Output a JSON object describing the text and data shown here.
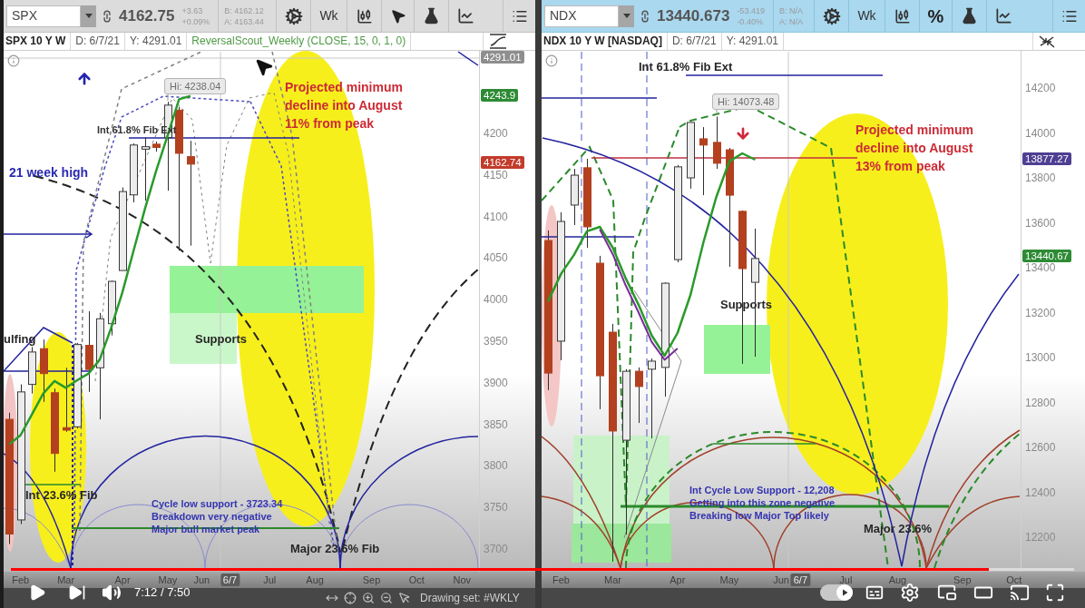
{
  "panels": [
    {
      "selected": false,
      "toolbar": {
        "symbol": "SPX",
        "price": "4162.75",
        "change": "+3.63",
        "change_percent": "+0.09%",
        "bid": "B: 4162.12",
        "ask": "A: 4163.44",
        "interval": "Wk"
      },
      "header": {
        "title": "SPX 10 Y W",
        "date": "D: 6/7/21",
        "y_value": "Y: 4291.01",
        "study": "ReversalScout_Weekly (CLOSE, 15, 0, 1, 0)"
      },
      "annotations": [
        {
          "kind": "price_label",
          "text": "Hi: 4238.04"
        },
        {
          "kind": "small_label",
          "text": "Int 61.8% Fib Ext"
        },
        {
          "kind": "callout",
          "lines": [
            "Projected minimum",
            "decline into August",
            "11% from peak"
          ]
        },
        {
          "kind": "heading",
          "text": "21 week high"
        },
        {
          "kind": "label",
          "text": "ulfing"
        },
        {
          "kind": "label",
          "text": "Supports"
        },
        {
          "kind": "label",
          "text": "Int 23.6% Fib"
        },
        {
          "kind": "note",
          "lines": [
            "Cycle low support - 3723.34",
            "Breakdown very negative",
            "Major bull market peak"
          ]
        },
        {
          "kind": "label",
          "text": "Major 23.6% Fib"
        }
      ],
      "price_tags": [
        {
          "text": "4291.01",
          "color": "#8e8e8e"
        },
        {
          "text": "4243.9",
          "color": "#2e8b35"
        },
        {
          "text": "4162.74",
          "color": "#c23b2b"
        }
      ],
      "chart_data": {
        "type": "candlestick",
        "categories": [
          null,
          "Feb",
          null,
          null,
          null,
          "Mar",
          null,
          null,
          null,
          null,
          "Apr",
          null,
          null,
          null,
          "May",
          null,
          null,
          "Jun",
          null,
          null,
          null,
          null,
          null,
          "Jul",
          null,
          null,
          null,
          "Aug",
          null,
          null,
          null,
          null,
          "Sep",
          null,
          null,
          null,
          "Oct",
          null,
          null,
          null,
          "Nov",
          null
        ],
        "ylim": [
          3672.7,
          4299.3
        ],
        "yticks": [
          4200,
          4150,
          4100,
          4050,
          4000,
          3950,
          3900,
          3850,
          3800,
          3750,
          3700
        ],
        "ohlc": [
          [
            3856,
            3864,
            3706,
            3718
          ],
          [
            3735,
            3898,
            3730,
            3889
          ],
          [
            3898,
            3943,
            3887,
            3937
          ],
          [
            3941,
            3952,
            3877,
            3911
          ],
          [
            3888,
            3893,
            3793,
            3815
          ],
          [
            3846,
            3918,
            3841,
            3843
          ],
          [
            3847,
            3948,
            3845,
            3946
          ],
          [
            3945,
            3986,
            3889,
            3916
          ],
          [
            3918,
            3984,
            3856,
            3977
          ],
          [
            3971,
            4023,
            3957,
            4022
          ],
          [
            4035,
            4135,
            4035,
            4130
          ],
          [
            4126,
            4188,
            4117,
            4186
          ],
          [
            4181,
            4195,
            4119,
            4184
          ],
          [
            4187,
            4190,
            4178,
            4183
          ],
          [
            4195,
            4238,
            4131,
            4234
          ],
          [
            4228,
            4232,
            4059,
            4176
          ],
          [
            4172,
            4191,
            4065,
            4163
          ],
          null,
          null,
          null,
          null,
          null,
          null,
          null,
          null,
          null,
          null,
          null,
          null,
          null,
          null,
          null,
          null,
          null,
          null,
          null,
          null,
          null,
          null,
          null,
          null,
          null
        ],
        "series": [
          {
            "type": "line",
            "color": "#2a9a2a",
            "values": [
              3826,
              3837,
              3862,
              3887,
              3902,
              3894,
              3903,
              3911,
              3928,
              3966,
              4009,
              4060,
              4110,
              4156,
              4198,
              4241,
              4245,
              null,
              null,
              null,
              null,
              null,
              null,
              null,
              null,
              null,
              null,
              null,
              null,
              null,
              null,
              null,
              null,
              null,
              null,
              null,
              null,
              null,
              null,
              null,
              null,
              null
            ]
          }
        ]
      },
      "date_tag": "6/7",
      "bottom_bar": {
        "drawing_set": "Drawing set: #WKLY"
      }
    },
    {
      "selected": true,
      "toolbar": {
        "symbol": "NDX",
        "price": "13440.673",
        "change": "-53.419",
        "change_percent": "-0.40%",
        "bid": "B: N/A",
        "ask": "A: N/A",
        "interval": "Wk",
        "percent": "%"
      },
      "header": {
        "title": "NDX 10 Y W [NASDAQ]",
        "date": "D: 6/7/21",
        "y_value": "Y: 4291.01"
      },
      "annotations": [
        {
          "kind": "label",
          "text": "Int 61.8% Fib Ext"
        },
        {
          "kind": "price_label",
          "text": "Hi: 14073.48"
        },
        {
          "kind": "callout",
          "lines": [
            "Projected minimum",
            "decline into August",
            "13% from peak"
          ]
        },
        {
          "kind": "label",
          "text": "Supports"
        },
        {
          "kind": "note",
          "lines": [
            "Int Cycle Low Support - 12,208",
            "Getting into this zone negative",
            "Breaking low Major Top likely"
          ]
        },
        {
          "kind": "label",
          "text": "Major 23.6%"
        }
      ],
      "price_tags": [
        {
          "text": "13877.27",
          "color": "#4f3f92"
        },
        {
          "text": "13440.67",
          "color": "#2e8b35"
        }
      ],
      "chart_data": {
        "type": "candlestick",
        "categories": [
          null,
          "Feb",
          null,
          null,
          null,
          "Mar",
          null,
          null,
          null,
          null,
          "Apr",
          null,
          null,
          null,
          "May",
          null,
          null,
          null,
          "Jun",
          null,
          null,
          null,
          null,
          "Jul",
          null,
          null,
          null,
          "Aug",
          null,
          null,
          null,
          null,
          "Sep",
          null,
          null,
          null,
          "Oct"
        ],
        "ylim": [
          12046.5,
          14365.7
        ],
        "yticks": [
          14200,
          14000,
          13800,
          13600,
          13400,
          13200,
          13000,
          12800,
          12600,
          12400,
          12200
        ],
        "ohlc": [
          [
            13521,
            13566,
            12855,
            12931
          ],
          [
            13073,
            13647,
            12988,
            13606
          ],
          [
            13679,
            13840,
            13590,
            13812
          ],
          [
            13845,
            13885,
            13489,
            13582
          ],
          [
            13420,
            13453,
            12770,
            12919
          ],
          [
            13113,
            13150,
            12091,
            12673
          ],
          [
            12632,
            12948,
            12212,
            12939
          ],
          [
            12939,
            12956,
            12709,
            12871
          ],
          [
            12948,
            12996,
            12640,
            12984
          ],
          [
            12956,
            13335,
            12826,
            13331
          ],
          [
            13436,
            13857,
            13424,
            13849
          ],
          [
            13800,
            14047,
            13752,
            14047
          ],
          [
            13974,
            14026,
            13723,
            13946
          ],
          [
            13958,
            14073,
            13840,
            13865
          ],
          [
            13925,
            13933,
            13404,
            13723
          ],
          [
            13651,
            13655,
            12972,
            13396
          ],
          [
            13335,
            13574,
            13004,
            13441
          ],
          null,
          null,
          null,
          null,
          null,
          null,
          null,
          null,
          null,
          null,
          null,
          null,
          null,
          null,
          null,
          null,
          null,
          null,
          null,
          null
        ],
        "series": [
          {
            "type": "line",
            "color": "#2a9a2a",
            "values": [
              13250,
              13372,
              13457,
              13562,
              13582,
              13489,
              13352,
              13234,
              13099,
              13008,
              13109,
              13279,
              13513,
              13715,
              13873,
              13909,
              13881,
              null,
              null,
              null,
              null,
              null,
              null,
              null,
              null,
              null,
              null,
              null,
              null,
              null,
              null,
              null,
              null,
              null,
              null,
              null,
              null
            ]
          },
          {
            "type": "line",
            "color": "#7a2a9a",
            "values": [
              null,
              null,
              null,
              null,
              13570,
              13460,
              13320,
              13200,
              13070,
              12990,
              13040,
              null,
              null,
              null,
              null,
              null,
              null,
              null,
              null,
              null,
              null,
              null,
              null,
              null,
              null,
              null,
              null,
              null,
              null,
              null,
              null,
              null,
              null,
              null,
              null,
              null,
              null
            ]
          }
        ]
      },
      "date_tag": "6/7"
    }
  ],
  "player": {
    "progress": {
      "level": 0.92
    },
    "time": "7:12 / 7:50",
    "autoplay": {
      "on": true
    }
  }
}
